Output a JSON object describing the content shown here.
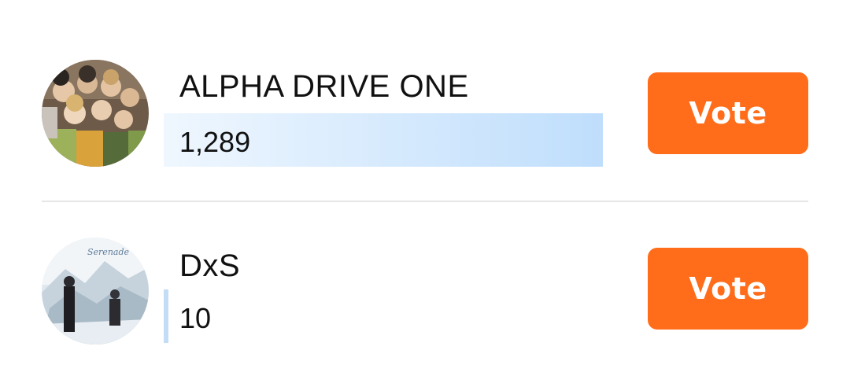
{
  "candidates": [
    {
      "name": "ALPHA DRIVE ONE",
      "votes": "1,289",
      "vote_share": 1.0,
      "vote_label": "Vote",
      "avatar": "group-photo"
    },
    {
      "name": "DxS",
      "votes": "10",
      "vote_share": 0.008,
      "vote_label": "Vote",
      "avatar": "duo-photo-winter"
    }
  ],
  "colors": {
    "vote_button": "#ff6d1a",
    "bar": "#bfdefc",
    "divider": "#e6e6e6"
  }
}
